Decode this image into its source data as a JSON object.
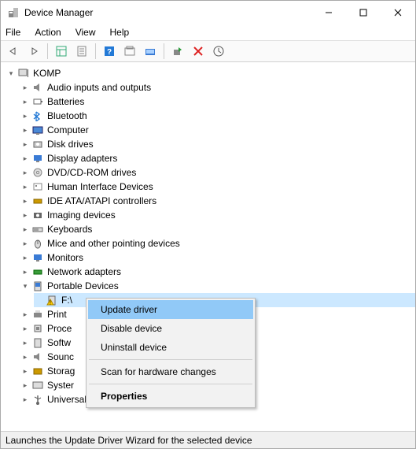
{
  "window": {
    "title": "Device Manager"
  },
  "menu": {
    "file": "File",
    "action": "Action",
    "view": "View",
    "help": "Help"
  },
  "tree": {
    "root": "KOMP",
    "audio": "Audio inputs and outputs",
    "batteries": "Batteries",
    "bluetooth": "Bluetooth",
    "computer": "Computer",
    "disk": "Disk drives",
    "display": "Display adapters",
    "dvd": "DVD/CD-ROM drives",
    "hid": "Human Interface Devices",
    "ide": "IDE ATA/ATAPI controllers",
    "imaging": "Imaging devices",
    "keyboards": "Keyboards",
    "mice": "Mice and other pointing devices",
    "monitors": "Monitors",
    "network": "Network adapters",
    "portable": "Portable Devices",
    "portable_child": "F:\\",
    "print": "Print",
    "proce": "Proce",
    "softw": "Softw",
    "sounc": "Sounc",
    "storag": "Storag",
    "syster": "Syster",
    "usb": "Universal Serial Bus controllers"
  },
  "ctx": {
    "update": "Update driver",
    "disable": "Disable device",
    "uninstall": "Uninstall device",
    "scan": "Scan for hardware changes",
    "properties": "Properties"
  },
  "status": "Launches the Update Driver Wizard for the selected device"
}
